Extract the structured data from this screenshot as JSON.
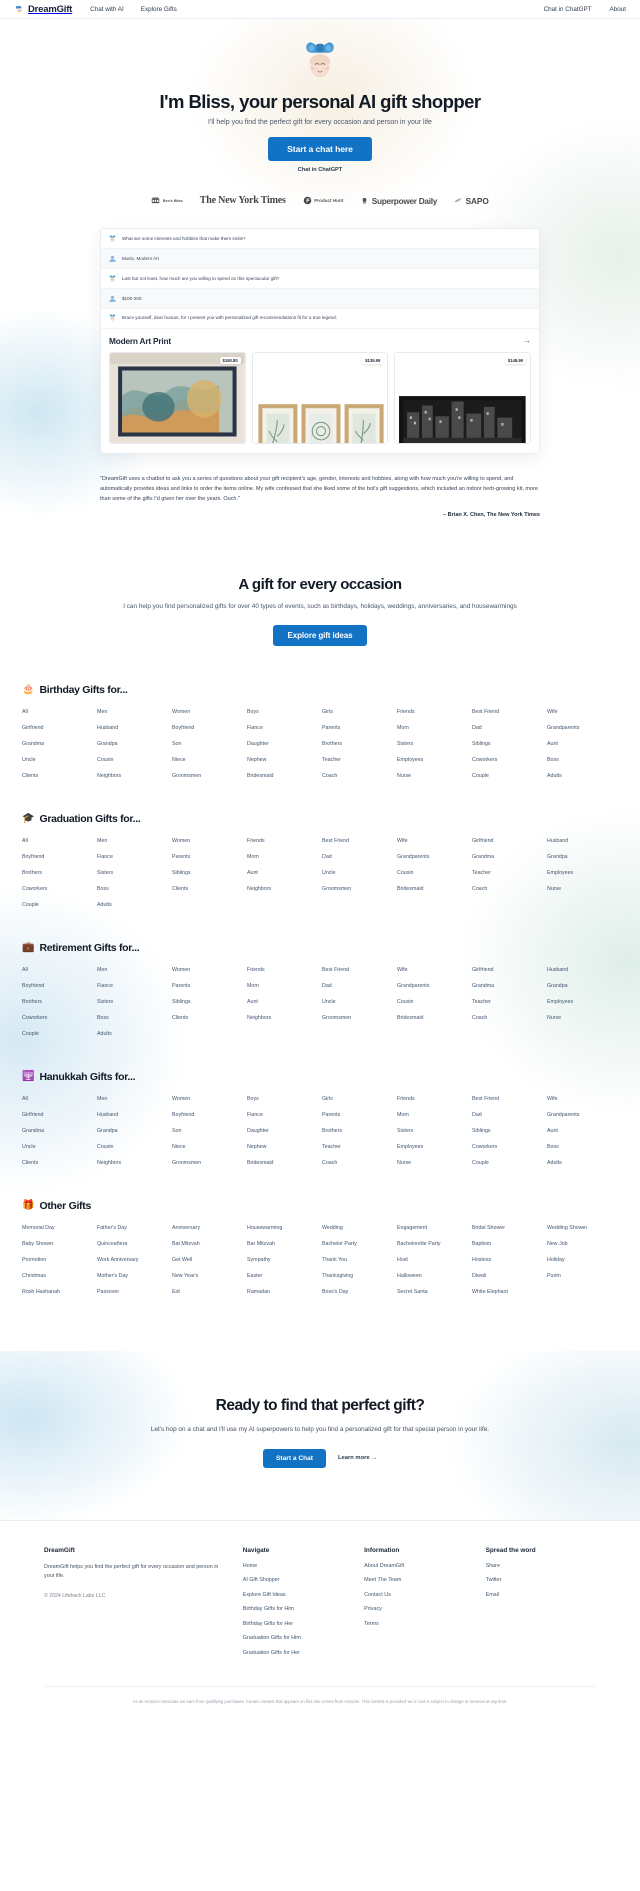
{
  "nav": {
    "brand": "DreamGift",
    "brand_icon": "gift-bow-avatar-icon",
    "left_links": [
      {
        "label": "Chat with AI",
        "name": "nav-link-chat-with-ai"
      },
      {
        "label": "Explore Gifts",
        "name": "nav-link-explore-gifts"
      }
    ],
    "right_links": [
      {
        "label": "Chat in ChatGPT",
        "name": "nav-link-chat-in-chatgpt"
      },
      {
        "label": "About",
        "name": "nav-link-about"
      }
    ]
  },
  "hero": {
    "avatar_icon": "bliss-avatar-icon",
    "title": "I'm Bliss, your personal AI gift shopper",
    "subtitle": "I'll help you find the perfect gift for every occasion and person in your life",
    "cta_label": "Start a chat here",
    "sub_link": "Chat in ChatGPT"
  },
  "press": {
    "items": [
      {
        "label": "Ben's Bites",
        "icon": "bens-bites-logo-icon"
      },
      {
        "label": "The New York Times",
        "icon": "nyt-logo-icon"
      },
      {
        "label": "Product Hunt",
        "icon": "product-hunt-logo-icon"
      },
      {
        "label": "Superpower Daily",
        "icon": "superpower-daily-logo-icon"
      },
      {
        "label": "SAPO",
        "icon": "sapo-logo-icon"
      }
    ]
  },
  "demo": {
    "messages": [
      {
        "role": "bot",
        "text": "What are some interests and hobbies that make them smile?"
      },
      {
        "role": "user",
        "text": "Music, Modern Art"
      },
      {
        "role": "bot",
        "text": "Last but not least, how much are you willing to spend on this spectacular gift?"
      },
      {
        "role": "user",
        "text": "$100-200"
      },
      {
        "role": "bot",
        "text": "Brace yourself, dear human, for I present you with personalized gift recommendations fit for a true legend:"
      }
    ],
    "recommendation_title": "Modern Art Print",
    "arrow_icon": "arrow-right-icon",
    "products": [
      {
        "price": "$150.80",
        "name": "abstract-art-print-over-sofa"
      },
      {
        "price": "$135.99",
        "name": "framed-botanical-triptych"
      },
      {
        "price": "$148.99",
        "name": "black-and-white-city-print"
      }
    ]
  },
  "testimonial": {
    "quote": "\"DreamGift uses a chatbot to ask you a series of questions about your gift recipient's age, gender, interests and hobbies, along with how much you're willing to spend, and automatically provides ideas and links to order the items online. My wife confessed that she liked some of the bot's gift suggestions, which included an indoor herb-growing kit, more than some of the gifts I'd given her over the years. Ouch.\"",
    "attribution": "– Brian X. Chen, The New York Times"
  },
  "occasion": {
    "title": "A gift for every occasion",
    "subtitle": "I can help you find personalized gifts for over 40 types of events, such as birthdays, holidays, weddings, anniversaries, and housewarmings",
    "cta_label": "Explore gift ideas"
  },
  "categories": [
    {
      "emoji": "🎂",
      "icon": "birthday-cake-icon",
      "title": "Birthday Gifts for...",
      "links": [
        "All",
        "Men",
        "Women",
        "Boys",
        "Girls",
        "Friends",
        "Best Friend",
        "Wife",
        "Girlfriend",
        "Husband",
        "Boyfriend",
        "Fiance",
        "Parents",
        "Mom",
        "Dad",
        "Grandparents",
        "Grandma",
        "Grandpa",
        "Son",
        "Daughter",
        "Brothers",
        "Sisters",
        "Siblings",
        "Aunt",
        "Uncle",
        "Cousin",
        "Niece",
        "Nephew",
        "Teacher",
        "Employees",
        "Coworkers",
        "Boss",
        "Clients",
        "Neighbors",
        "Groomsmen",
        "Bridesmaid",
        "Coach",
        "Nurse",
        "Couple",
        "Adults"
      ]
    },
    {
      "emoji": "🎓",
      "icon": "graduation-cap-icon",
      "title": "Graduation Gifts for...",
      "links": [
        "All",
        "Men",
        "Women",
        "Friends",
        "Best Friend",
        "Wife",
        "Girlfriend",
        "Husband",
        "Boyfriend",
        "Fiance",
        "Parents",
        "Mom",
        "Dad",
        "Grandparents",
        "Grandma",
        "Grandpa",
        "Brothers",
        "Sisters",
        "Siblings",
        "Aunt",
        "Uncle",
        "Cousin",
        "Teacher",
        "Employees",
        "Coworkers",
        "Boss",
        "Clients",
        "Neighbors",
        "Groomsmen",
        "Bridesmaid",
        "Coach",
        "Nurse",
        "Couple",
        "Adults"
      ]
    },
    {
      "emoji": "💼",
      "icon": "briefcase-icon",
      "title": "Retirement Gifts for...",
      "links": [
        "All",
        "Men",
        "Women",
        "Friends",
        "Best Friend",
        "Wife",
        "Girlfriend",
        "Husband",
        "Boyfriend",
        "Fiance",
        "Parents",
        "Mom",
        "Dad",
        "Grandparents",
        "Grandma",
        "Grandpa",
        "Brothers",
        "Sisters",
        "Siblings",
        "Aunt",
        "Uncle",
        "Cousin",
        "Teacher",
        "Employees",
        "Coworkers",
        "Boss",
        "Clients",
        "Neighbors",
        "Groomsmen",
        "Bridesmaid",
        "Coach",
        "Nurse",
        "Couple",
        "Adults"
      ]
    },
    {
      "emoji": "🕎",
      "icon": "menorah-icon",
      "title": "Hanukkah Gifts for...",
      "links": [
        "All",
        "Men",
        "Women",
        "Boys",
        "Girls",
        "Friends",
        "Best Friend",
        "Wife",
        "Girlfriend",
        "Husband",
        "Boyfriend",
        "Fiance",
        "Parents",
        "Mom",
        "Dad",
        "Grandparents",
        "Grandma",
        "Grandpa",
        "Son",
        "Daughter",
        "Brothers",
        "Sisters",
        "Siblings",
        "Aunt",
        "Uncle",
        "Cousin",
        "Niece",
        "Nephew",
        "Teacher",
        "Employees",
        "Coworkers",
        "Boss",
        "Clients",
        "Neighbors",
        "Groomsmen",
        "Bridesmaid",
        "Coach",
        "Nurse",
        "Couple",
        "Adults"
      ]
    },
    {
      "emoji": "🎁",
      "icon": "gift-box-icon",
      "title": "Other Gifts",
      "links": [
        "Memorial Day",
        "Father's Day",
        "Anniversary",
        "Housewarming",
        "Wedding",
        "Engagement",
        "Bridal Shower",
        "Wedding Shower",
        "Baby Shower",
        "Quinceañera",
        "Bat Mitzvah",
        "Bar Mitzvah",
        "Bachelor Party",
        "Bachelorette Party",
        "Baptism",
        "New Job",
        "Promotion",
        "Work Anniversary",
        "Get Well",
        "Sympathy",
        "Thank You",
        "Host",
        "Hostess",
        "Holiday",
        "Christmas",
        "Mother's Day",
        "New Year's",
        "Easter",
        "Thanksgiving",
        "Halloween",
        "Diwali",
        "Purim",
        "Rosh Hashanah",
        "Passover",
        "Eid",
        "Ramadan",
        "Boss's Day",
        "Secret Santa",
        "White Elephant"
      ]
    }
  ],
  "final_cta": {
    "title": "Ready to find that perfect gift?",
    "subtitle": "Let's hop on a chat and I'll use my AI superpowers to help you find a personalized gift for that special person in your life.",
    "button_label": "Start a Chat",
    "learn_more": "Learn more →"
  },
  "footer": {
    "brand": "DreamGift",
    "brand_desc": "DreamGift helps you find the perfect gift for every occasion and person in your life.",
    "copyright": "© 2024 Lifehack Labs LLC",
    "columns": [
      {
        "heading": "Navigate",
        "links": [
          "Home",
          "AI Gift Shopper",
          "Explore Gift Ideas",
          "Birthday Gifts for Him",
          "Birthday Gifts for Her",
          "Graduation Gifts for Him",
          "Graduation Gifts for Her"
        ]
      },
      {
        "heading": "Information",
        "links": [
          "About DreamGift",
          "Meet The Team",
          "Contact Us",
          "Privacy",
          "Terms"
        ]
      },
      {
        "heading": "Spread the word",
        "links": [
          "Share",
          "Twitter",
          "Email"
        ]
      }
    ],
    "disclaimer": "As an Amazon Associate we earn from qualifying purchases. Certain content that appears on this site comes from Amazon. This content is provided 'as is' and is subject to change or removal at any time."
  },
  "colors": {
    "accent": "#1272c4",
    "link": "#41566f",
    "heading": "#121a26"
  }
}
